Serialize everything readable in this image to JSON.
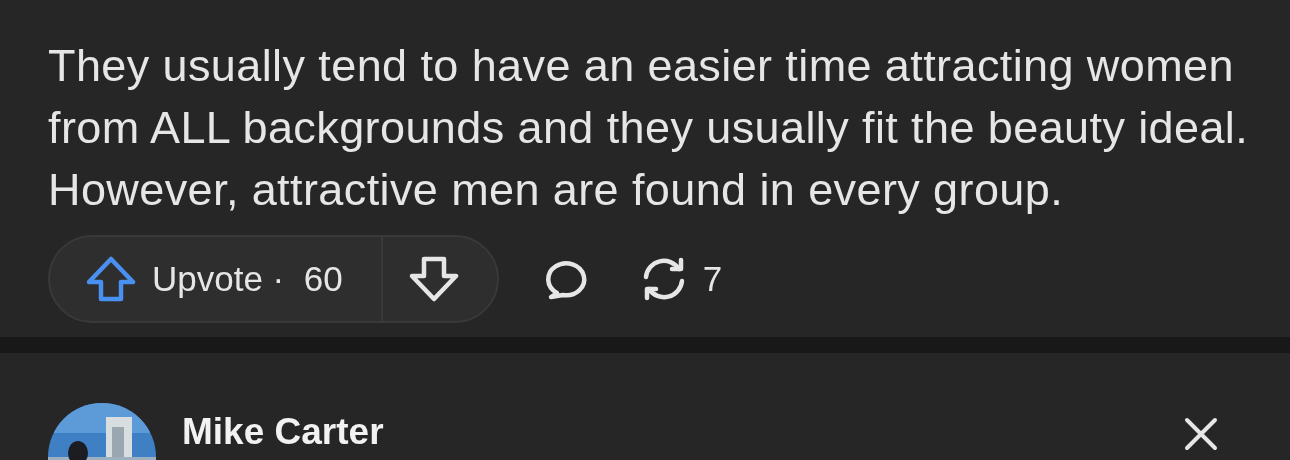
{
  "answer": {
    "text": "They usually tend to have an easier time attracting women from ALL backgrounds and they usually fit the beauty ideal. However, attractive men are found in every group.",
    "actions": {
      "upvote": {
        "label": "Upvote",
        "separator": "·",
        "count": "60",
        "selected": false
      },
      "downvote": {
        "selected": false
      },
      "share_count": "7"
    }
  },
  "next_post": {
    "author": "Mike Carter"
  }
}
